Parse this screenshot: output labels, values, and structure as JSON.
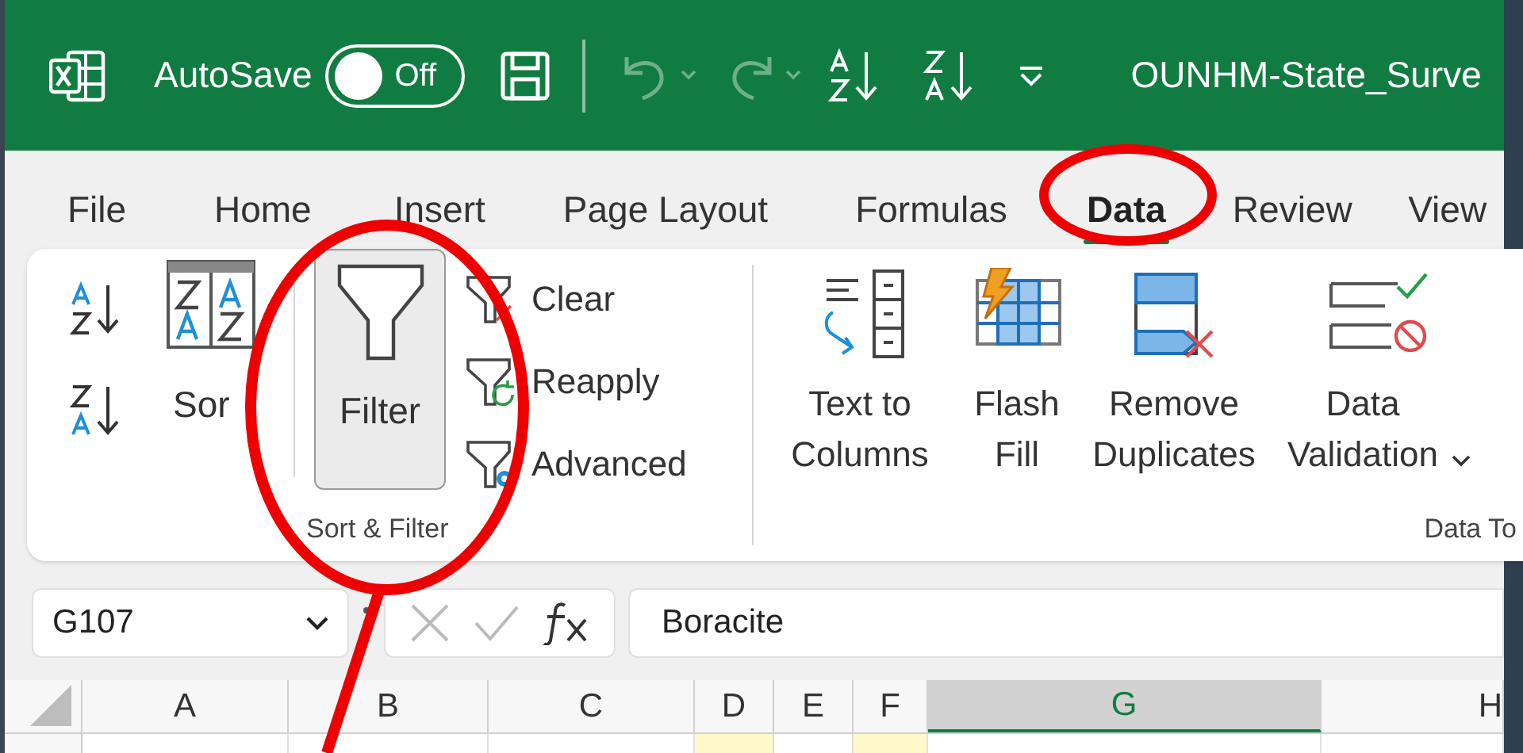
{
  "title_bar": {
    "autosave": {
      "label": "AutoSave",
      "on": false,
      "state_label": "Off"
    },
    "quick_access": [
      {
        "kind": "save",
        "disabled": false
      },
      {
        "kind": "undo",
        "disabled": true
      },
      {
        "kind": "redo",
        "disabled": true
      },
      {
        "kind": "sort_az",
        "disabled": false
      },
      {
        "kind": "sort_za",
        "disabled": false
      },
      {
        "kind": "customize",
        "disabled": false
      }
    ],
    "document_title": "OUNHM-State_Surve"
  },
  "tabs": [
    {
      "label": "File",
      "selected": false
    },
    {
      "label": "Home",
      "selected": false
    },
    {
      "label": "Insert",
      "selected": false
    },
    {
      "label": "Page Layout",
      "selected": false
    },
    {
      "label": "Formulas",
      "selected": false
    },
    {
      "label": "Data",
      "selected": true
    },
    {
      "label": "Review",
      "selected": false
    },
    {
      "label": "View",
      "selected": false
    }
  ],
  "ribbon": {
    "groups": [
      {
        "label": "Sort & Filter",
        "commands": [
          {
            "kind": "sort_pair"
          },
          {
            "kind": "sort",
            "label": "Sor"
          },
          {
            "kind": "filter",
            "label": "Filter",
            "pressed": true
          },
          {
            "kind": "filter_options",
            "items": [
              {
                "label": "Clear",
                "disabled": false
              },
              {
                "label": "Reapply",
                "disabled": false
              },
              {
                "label": "Advanced",
                "disabled": false
              }
            ]
          }
        ]
      },
      {
        "label": "Data To",
        "commands": [
          {
            "kind": "text_to_columns",
            "label": "Text to\nColumns"
          },
          {
            "kind": "flash_fill",
            "label": "Flash\nFill"
          },
          {
            "kind": "remove_duplicates",
            "label": "Remove\nDuplicates"
          },
          {
            "kind": "data_validation",
            "label": "Data\nValidation",
            "dropdown": true
          }
        ]
      }
    ]
  },
  "formula_bar": {
    "name_box": "G107",
    "value": "Boracite"
  },
  "columns": [
    {
      "label": "A",
      "selected": false,
      "highlighted": false
    },
    {
      "label": "B",
      "selected": false,
      "highlighted": false
    },
    {
      "label": "C",
      "selected": false,
      "highlighted": false
    },
    {
      "label": "D",
      "selected": false,
      "highlighted": true
    },
    {
      "label": "E",
      "selected": false,
      "highlighted": false
    },
    {
      "label": "F",
      "selected": false,
      "highlighted": true
    },
    {
      "label": "G",
      "selected": true,
      "highlighted": false
    },
    {
      "label": "H",
      "selected": false,
      "highlighted": false
    }
  ]
}
